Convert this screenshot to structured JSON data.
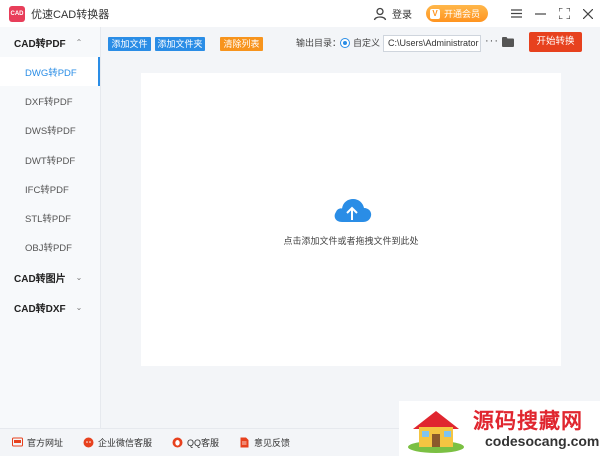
{
  "app": {
    "logo_text": "CAD",
    "title": "优速CAD转换器"
  },
  "titlebar": {
    "login": "登录",
    "vip": "开通会员"
  },
  "sidebar": {
    "groups": [
      {
        "label": "CAD转PDF",
        "items": [
          "DWG转PDF",
          "DXF转PDF",
          "DWS转PDF",
          "DWT转PDF",
          "IFC转PDF",
          "STL转PDF",
          "OBJ转PDF"
        ]
      },
      {
        "label": "CAD转图片"
      },
      {
        "label": "CAD转DXF"
      }
    ]
  },
  "toolbar": {
    "add_file": "添加文件",
    "add_folder": "添加文件夹",
    "clear_list": "清除列表",
    "output_label": "输出目录：",
    "radio_label": "自定义",
    "path_value": "C:\\Users\\Administrator",
    "more": "···",
    "start": "开始转换"
  },
  "drop": {
    "hint": "点击添加文件或者拖拽文件到此处"
  },
  "footer": {
    "site": "官方网址",
    "wechat": "企业微信客服",
    "qq": "QQ客服",
    "feedback": "意见反馈"
  },
  "watermark": {
    "title": "源码搜藏网",
    "url": "codesocang.com"
  },
  "colors": {
    "accent": "#2a8de6",
    "start": "#e7411e",
    "orange": "#f7941d",
    "logo": "#e83e5a"
  }
}
